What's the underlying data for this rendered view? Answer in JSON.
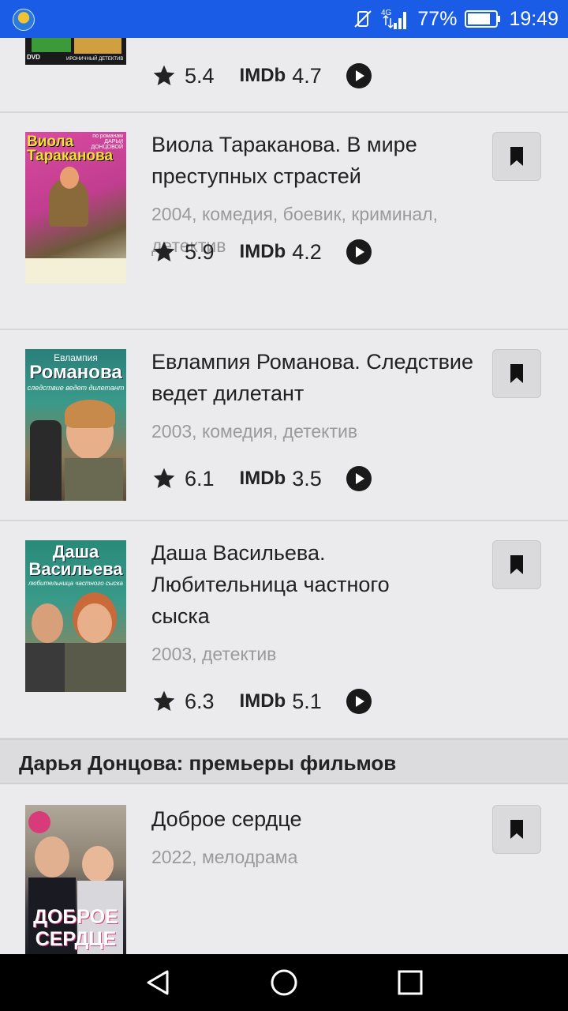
{
  "status_bar": {
    "battery": "77%",
    "time": "19:49",
    "network": "4G"
  },
  "items": [
    {
      "poster_text": "ИРОНИЧНЫЙ ДЕТЕКТИВ",
      "poster_badge": "DVD",
      "rating": "5.4",
      "imdb_label": "IMDb",
      "imdb": "4.7"
    },
    {
      "title": "Виола Тараканова. В мире преступных страстей",
      "meta": "2004, комедия, боевик, криминал, детектив",
      "poster_text": "Виола Тараканова",
      "poster_top": "по романам ДАРЬИ ДОНЦОВОЙ",
      "rating": "5.9",
      "imdb_label": "IMDb",
      "imdb": "4.2"
    },
    {
      "title": "Евлампия Романова. Следствие ведет дилетант",
      "meta": "2003, комедия, детектив",
      "poster_top": "Евлампия",
      "poster_text": "Романова",
      "poster_sub": "следствие ведет дилетант",
      "rating": "6.1",
      "imdb_label": "IMDb",
      "imdb": "3.5"
    },
    {
      "title": "Даша Васильева. Любительница частного сыска",
      "meta": "2003, детектив",
      "poster_top": "Даша",
      "poster_text": "Васильева",
      "poster_sub": "любительница частного сыска",
      "rating": "6.3",
      "imdb_label": "IMDb",
      "imdb": "5.1"
    }
  ],
  "section": {
    "title": "Дарья Донцова: премьеры фильмов"
  },
  "premiere": {
    "title": "Доброе сердце",
    "meta": "2022, мелодрама",
    "poster_text": "ДОБРОЕ СЕРДЦЕ"
  },
  "colors": {
    "status_bar": "#1a5ce6",
    "background": "#ebeaec",
    "meta_text": "#9a9a9a"
  }
}
